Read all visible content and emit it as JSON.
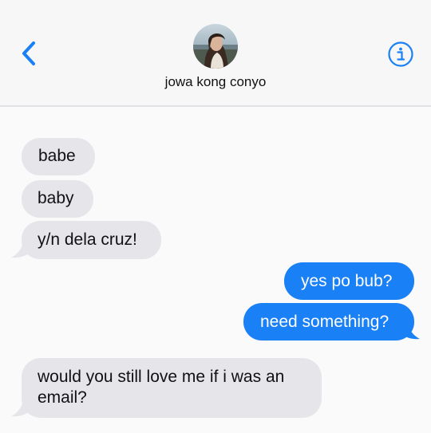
{
  "header": {
    "contact_name": "jowa kong conyo",
    "back_icon": "chevron-left-icon",
    "info_icon": "info-icon",
    "accent_color": "#1a80f5"
  },
  "messages": [
    {
      "direction": "incoming",
      "text": "babe"
    },
    {
      "direction": "incoming",
      "text": "baby"
    },
    {
      "direction": "incoming",
      "text": "y/n dela cruz!"
    },
    {
      "direction": "outgoing",
      "text": "yes po bub?"
    },
    {
      "direction": "outgoing",
      "text": "need something?"
    },
    {
      "direction": "incoming",
      "text": "would you still love me if i was an email?"
    }
  ],
  "colors": {
    "incoming_bubble": "#e6e5ea",
    "outgoing_bubble": "#1a80f5"
  }
}
